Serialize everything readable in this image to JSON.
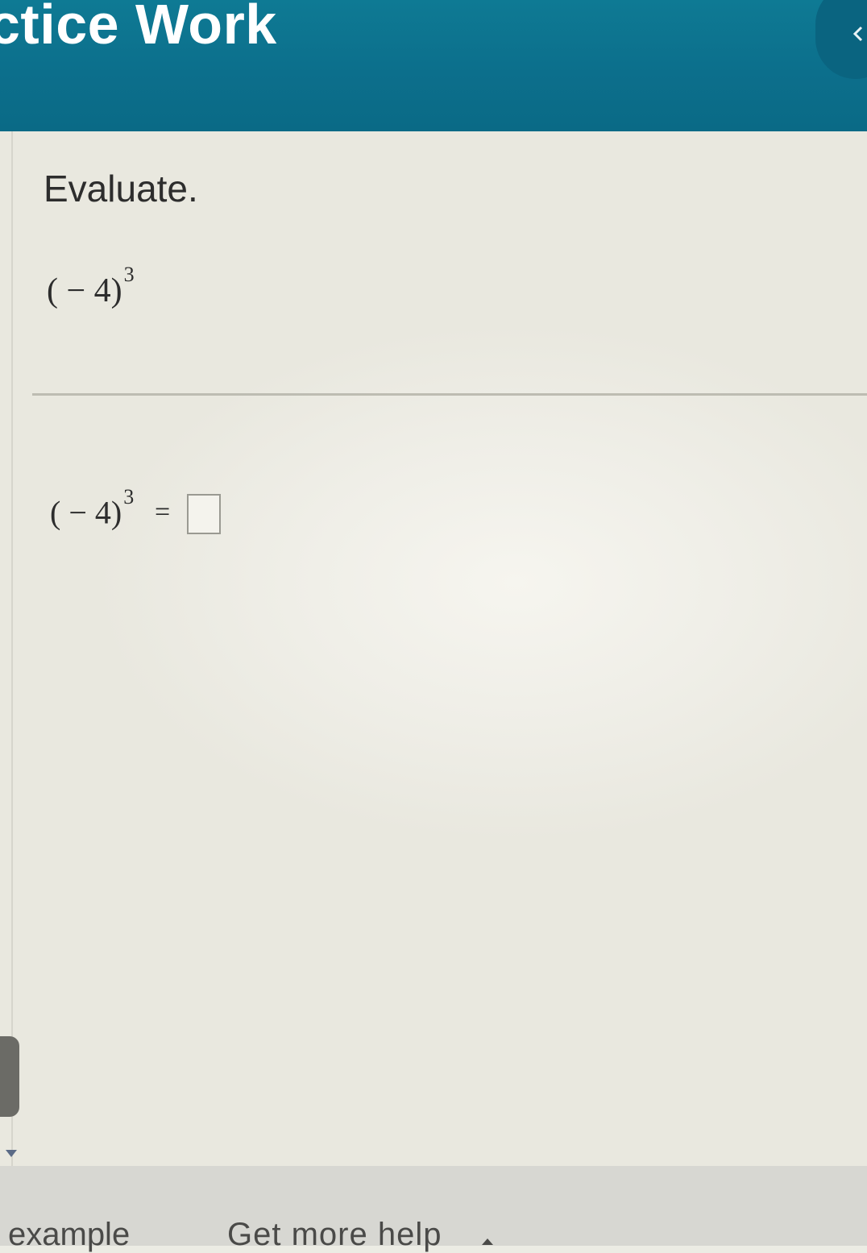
{
  "header": {
    "title": "ctice Work",
    "collapse_icon": "chevron-left-icon",
    "background_color": "#0c6f8c"
  },
  "question": {
    "instruction": "Evaluate.",
    "expression": {
      "base": "( − 4)",
      "exponent": "3"
    }
  },
  "answer": {
    "expression": {
      "base": "( − 4)",
      "exponent": "3"
    },
    "equals": "=",
    "input_value": ""
  },
  "scroll": {
    "down_icon": "caret-down-icon"
  },
  "footer": {
    "example_link": "example",
    "help_link": "Get more help",
    "help_icon": "caret-up-icon"
  }
}
